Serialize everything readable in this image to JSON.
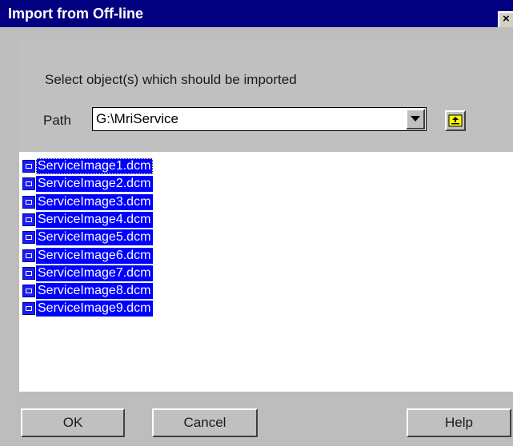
{
  "window": {
    "title": "Import from Off-line",
    "close_glyph": "×"
  },
  "dialog": {
    "prompt": "Select object(s) which should be imported",
    "path_label": "Path",
    "path_value": "G:\\MriService",
    "dropdown_icon": "chevron-down-icon",
    "up_folder_icon": "folder-up-icon"
  },
  "files": [
    {
      "name": "ServiceImage1.dcm",
      "selected": true
    },
    {
      "name": "ServiceImage2.dcm",
      "selected": true
    },
    {
      "name": "ServiceImage3.dcm",
      "selected": true
    },
    {
      "name": "ServiceImage4.dcm",
      "selected": true
    },
    {
      "name": "ServiceImage5.dcm",
      "selected": true
    },
    {
      "name": "ServiceImage6.dcm",
      "selected": true
    },
    {
      "name": "ServiceImage7.dcm",
      "selected": true
    },
    {
      "name": "ServiceImage8.dcm",
      "selected": true
    },
    {
      "name": "ServiceImage9.dcm",
      "selected": true
    }
  ],
  "buttons": {
    "ok": "OK",
    "cancel": "Cancel",
    "help": "Help"
  },
  "colors": {
    "titlebar": "#000080",
    "selection": "#0000ff",
    "dialog_bg": "#bdbdbd",
    "up_icon_yellow": "#ffff00"
  }
}
